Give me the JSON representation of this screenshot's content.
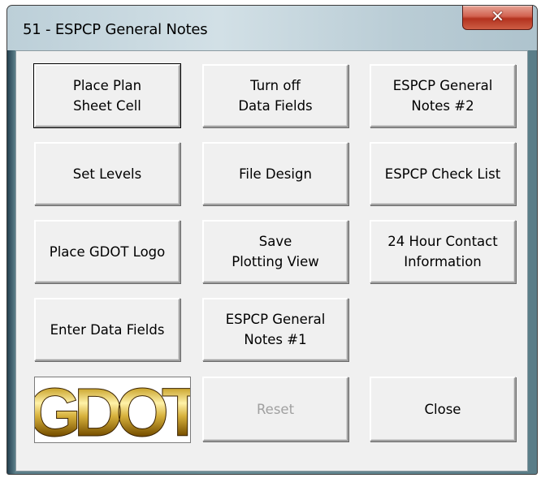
{
  "window": {
    "title": "51 - ESPCP General Notes",
    "close_icon": "close-x-icon"
  },
  "buttons": {
    "place_plan_sheet_cell": "Place Plan\nSheet Cell",
    "turn_off_data_fields": "Turn off\nData Fields",
    "espcp_general_notes_2": "ESPCP General\nNotes #2",
    "set_levels": "Set Levels",
    "file_design": "File Design",
    "espcp_check_list": "ESPCP Check List",
    "place_gdot_logo": "Place GDOT Logo",
    "save_plotting_view": "Save\nPlotting View",
    "contact_information": "24 Hour Contact\nInformation",
    "enter_data_fields": "Enter Data Fields",
    "espcp_general_notes_1": "ESPCP General\nNotes #1",
    "reset": "Reset",
    "close": "Close"
  },
  "logo": {
    "text": "GDOT",
    "color": "#b8860b"
  },
  "colors": {
    "close_button": "#c8452f",
    "dialog_background": "#f0f0f0",
    "disabled_text": "#a0a0a0"
  }
}
